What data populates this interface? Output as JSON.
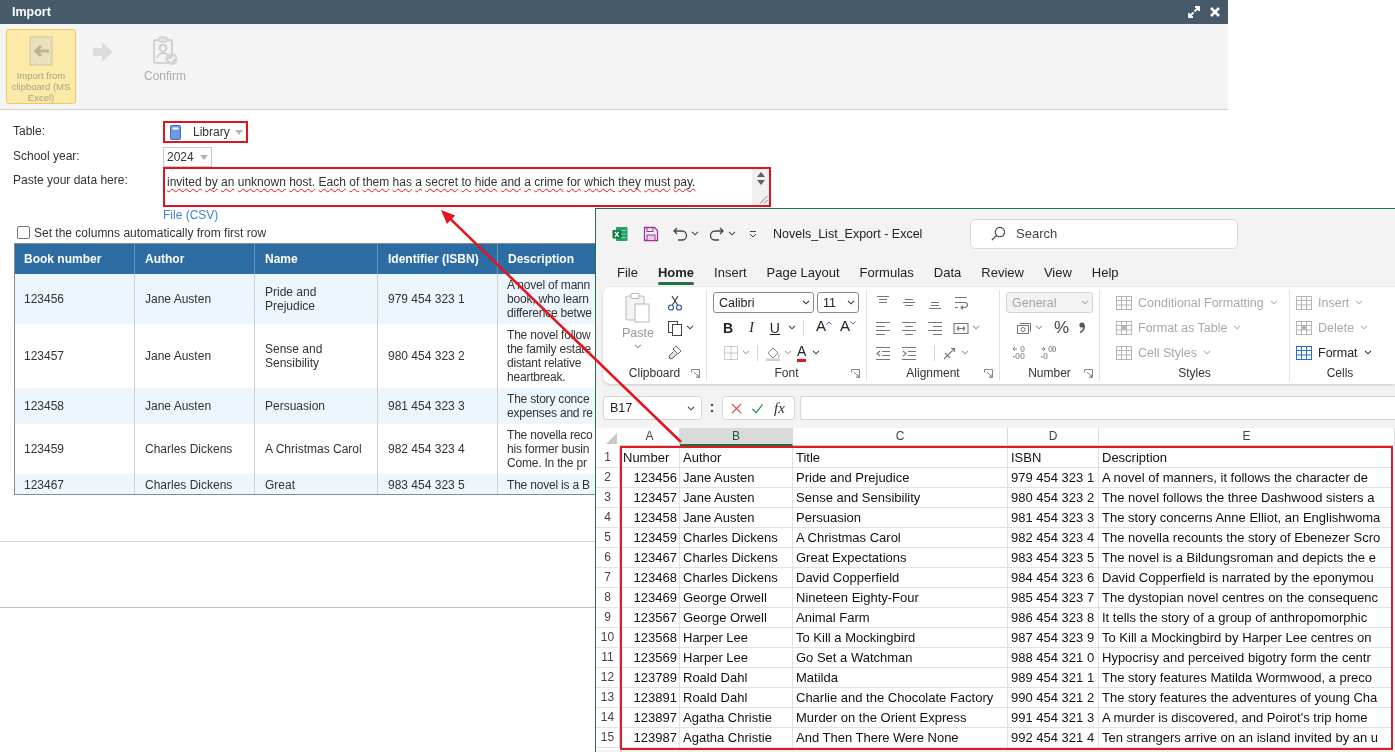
{
  "dialog": {
    "title": "Import",
    "toolbar": [
      {
        "label": "Import from clipboard (MS Excel)",
        "selected": true
      },
      {
        "label": "Confirm",
        "selected": false
      }
    ],
    "form": {
      "table_label": "Table:",
      "table_select": {
        "value": "Library",
        "highlighted": true
      },
      "year_label": "School year:",
      "year_select": {
        "value": "2024"
      },
      "paste_label": "Paste your data here:",
      "paste_field": {
        "value": "invited by an unknown host. Each of them has a secret to hide and a crime for which they must pay.",
        "highlighted": true
      },
      "file_link": "File (CSV)",
      "auto_columns": {
        "label": "Set the columns automatically from first row",
        "checked": false
      }
    },
    "table": {
      "columns": [
        "Book number",
        "Author",
        "Name",
        "Identifier (ISBN)",
        "Description"
      ],
      "rows": [
        {
          "number": "123456",
          "author": "Jane Austen",
          "name": "Pride and Prejudice",
          "isbn": "979 454 323 1",
          "description": [
            "A novel of mann",
            "book, who learn",
            "difference betwe"
          ]
        },
        {
          "number": "123457",
          "author": "Jane Austen",
          "name": "Sense and Sensibility",
          "isbn": "980 454 323 2",
          "description": [
            "The novel follow",
            "the family estate",
            "distant relative",
            "heartbreak."
          ]
        },
        {
          "number": "123458",
          "author": "Jane Austen",
          "name": "Persuasion",
          "isbn": "981 454 323 3",
          "description": [
            "The story conce",
            "expenses and re"
          ]
        },
        {
          "number": "123459",
          "author": "Charles Dickens",
          "name": "A Christmas Carol",
          "isbn": "982 454 323 4",
          "description": [
            "The novella reco",
            "his former busin",
            "Come. In the pr"
          ]
        },
        {
          "number": "123467",
          "author": "Charles Dickens",
          "name": "Great",
          "isbn": "983 454 323 5",
          "description": [
            "The novel is a B"
          ]
        }
      ]
    }
  },
  "excel": {
    "title": "Novels_List_Export - Excel",
    "search": {
      "placeholder": "Search"
    },
    "tabs": [
      {
        "label": "File",
        "selected": false
      },
      {
        "label": "Home",
        "selected": true
      },
      {
        "label": "Insert",
        "selected": false
      },
      {
        "label": "Page Layout",
        "selected": false
      },
      {
        "label": "Formulas",
        "selected": false
      },
      {
        "label": "Data",
        "selected": false
      },
      {
        "label": "Review",
        "selected": false
      },
      {
        "label": "View",
        "selected": false
      },
      {
        "label": "Help",
        "selected": false
      }
    ],
    "ribbon": {
      "clipboard": {
        "paste": {
          "label": "Paste",
          "disabled": true
        },
        "label": "Clipboard"
      },
      "font": {
        "name": "Calibri",
        "size": "11",
        "styles": [
          "B",
          "I",
          "U"
        ],
        "size_buttons": [
          "A",
          "A"
        ],
        "color_button": "A",
        "label": "Font"
      },
      "alignment": {
        "label": "Alignment"
      },
      "number": {
        "format": {
          "value": "General",
          "disabled": true
        },
        "percent": "%",
        "label": "Number"
      },
      "styles": {
        "items": [
          {
            "label": "Conditional Formatting",
            "disabled": true
          },
          {
            "label": "Format as Table",
            "disabled": true
          },
          {
            "label": "Cell Styles",
            "disabled": true
          }
        ],
        "label": "Styles"
      },
      "cells": {
        "items": [
          {
            "label": "Insert",
            "disabled": true
          },
          {
            "label": "Delete",
            "disabled": true
          },
          {
            "label": "Format",
            "disabled": false
          }
        ],
        "label": "Cells"
      }
    },
    "formula_bar": {
      "name_box": "B17",
      "function_button": "fx"
    },
    "sheet": {
      "highlighted": true,
      "columns": [
        {
          "label": "A",
          "selected": false
        },
        {
          "label": "B",
          "selected": true
        },
        {
          "label": "C",
          "selected": false
        },
        {
          "label": "D",
          "selected": false
        },
        {
          "label": "E",
          "selected": false
        }
      ],
      "row_numbers": [
        "1",
        "2",
        "3",
        "4",
        "5",
        "6",
        "7",
        "8",
        "9",
        "10",
        "11",
        "12",
        "13",
        "14",
        "15"
      ],
      "rows": [
        [
          "Number",
          "Author",
          "Title",
          "ISBN",
          "Description"
        ],
        [
          "123456",
          "Jane Austen",
          "Pride and Prejudice",
          "979 454 323 1",
          "A novel of manners, it follows the character de"
        ],
        [
          "123457",
          "Jane Austen",
          "Sense and Sensibility",
          "980 454 323 2",
          "The novel follows the three Dashwood sisters a"
        ],
        [
          "123458",
          "Jane Austen",
          "Persuasion",
          "981 454 323 3",
          "The story concerns Anne Elliot, an Englishwoma"
        ],
        [
          "123459",
          "Charles Dickens",
          "A Christmas Carol",
          "982 454 323 4",
          "The novella recounts the story of Ebenezer Scro"
        ],
        [
          "123467",
          "Charles Dickens",
          "Great Expectations",
          "983 454 323 5",
          "The novel is a Bildungsroman and depicts the e"
        ],
        [
          "123468",
          "Charles Dickens",
          "David Copperfield",
          "984 454 323 6",
          "David Copperfield is narrated by the eponymou"
        ],
        [
          "123469",
          "George Orwell",
          "Nineteen Eighty-Four",
          "985 454 323 7",
          "The dystopian novel centres on the consequenc"
        ],
        [
          "123567",
          "George Orwell",
          "Animal Farm",
          "986 454 323 8",
          "It tells the story of a group of anthropomorphic"
        ],
        [
          "123568",
          "Harper Lee",
          "To Kill a Mockingbird",
          "987 454 323 9",
          "To Kill a Mockingbird by Harper Lee centres on"
        ],
        [
          "123569",
          "Harper Lee",
          "Go Set a Watchman",
          "988 454 321 0",
          "Hypocrisy and perceived bigotry form the centr"
        ],
        [
          "123789",
          "Roald Dahl",
          "Matilda",
          "989 454 321 1",
          "The story features Matilda Wormwood, a preco"
        ],
        [
          "123891",
          "Roald Dahl",
          "Charlie and the Chocolate Factory",
          "990 454 321 2",
          "The story features the adventures of young Cha"
        ],
        [
          "123897",
          "Agatha Christie",
          "Murder on the Orient Express",
          "991 454 321 3",
          "A murder is discovered, and Poirot's trip home"
        ],
        [
          "123987",
          "Agatha Christie",
          "And Then There Were None",
          "992 454 321 4",
          "Ten strangers arrive on an island invited by an u"
        ]
      ]
    }
  }
}
